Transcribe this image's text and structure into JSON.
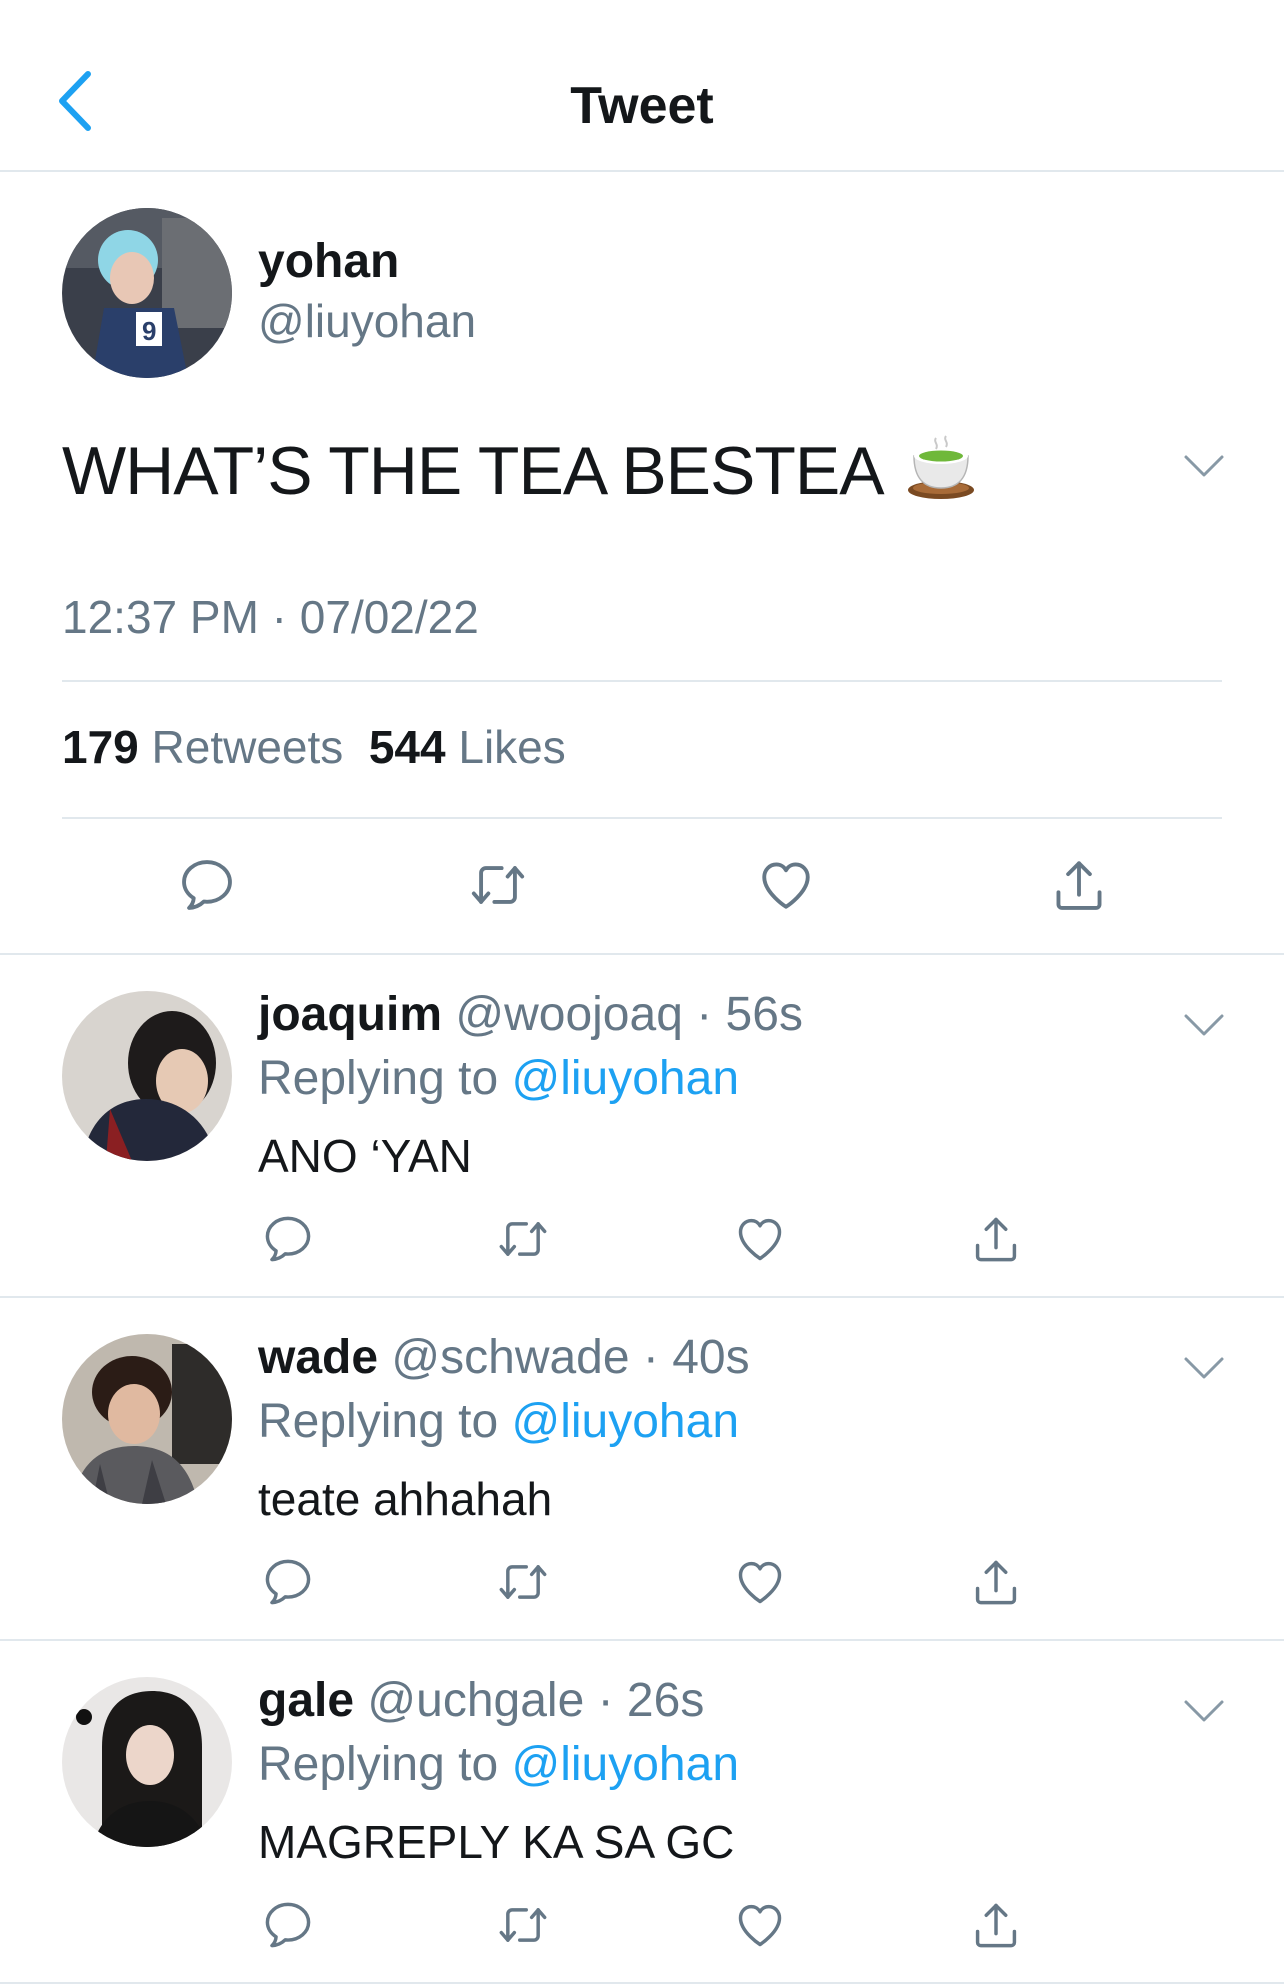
{
  "header": {
    "title": "Tweet",
    "back_icon": "chevron-left-icon"
  },
  "colors": {
    "accent": "#1da1f2",
    "muted": "#657786",
    "text": "#14171a",
    "divider": "#e1e8ed"
  },
  "main_tweet": {
    "display_name": "yohan",
    "handle": "@liuyohan",
    "text": "WHAT’S THE TEA BESTEA",
    "emoji": "teacup-emoji",
    "timestamp": "12:37 PM · 07/02/22",
    "retweet_count": "179",
    "retweet_label": "Retweets",
    "like_count": "544",
    "like_label": "Likes"
  },
  "replies": [
    {
      "display_name": "joaquim",
      "handle": "@woojoaq",
      "time": "56s",
      "replying_prefix": "Replying to",
      "replying_to": "@liuyohan",
      "text": "ANO ‘YAN"
    },
    {
      "display_name": "wade",
      "handle": "@schwade",
      "time": "40s",
      "replying_prefix": "Replying to",
      "replying_to": "@liuyohan",
      "text": "teate ahhahah"
    },
    {
      "display_name": "gale",
      "handle": "@uchgale",
      "time": "26s",
      "replying_prefix": "Replying to",
      "replying_to": "@liuyohan",
      "text": "MAGREPLY KA SA GC"
    }
  ]
}
